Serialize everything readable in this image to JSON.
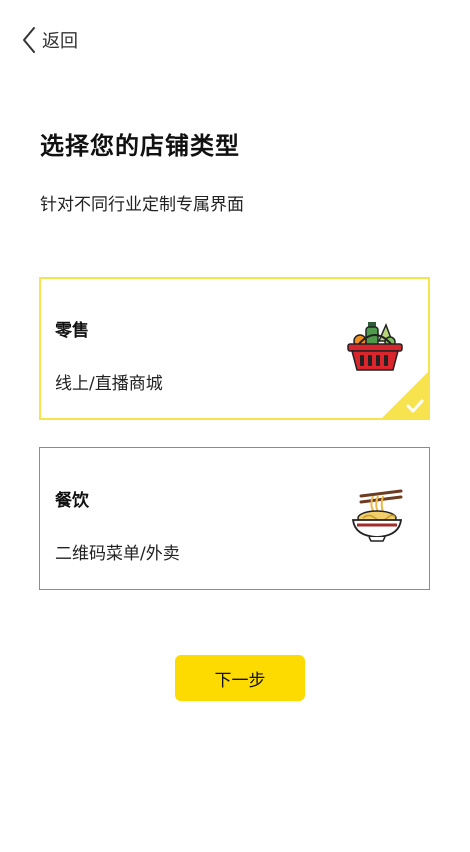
{
  "header": {
    "back_label": "返回",
    "back_icon": "chevron-left-icon"
  },
  "page": {
    "title": "选择您的店铺类型",
    "subtitle": "针对不同行业定制专属界面"
  },
  "store_types": [
    {
      "title": "零售",
      "description": "线上/直播商城",
      "icon": "shopping-basket-icon",
      "selected": true
    },
    {
      "title": "餐饮",
      "description": "二维码菜单/外卖",
      "icon": "noodle-bowl-icon",
      "selected": false
    }
  ],
  "actions": {
    "next_label": "下一步"
  },
  "colors": {
    "accent": "#fedb00",
    "selected_border": "#f7e34d",
    "card_border": "#8c8c8c",
    "basket_red": "#d9262c"
  }
}
